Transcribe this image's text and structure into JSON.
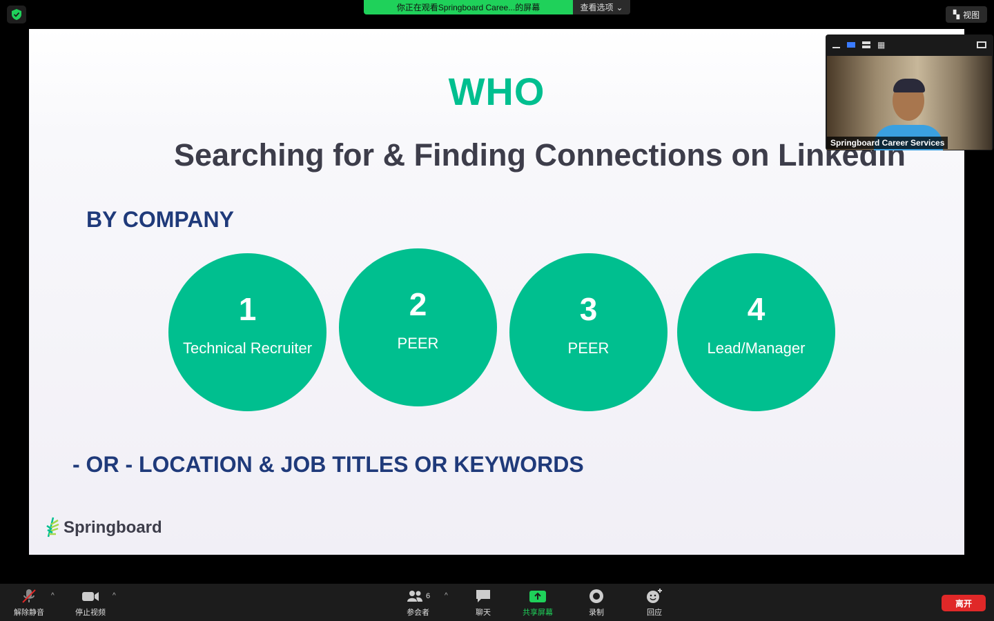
{
  "banner": {
    "viewing": "你正在观看Springboard Caree...的屏幕",
    "options": "查看选项"
  },
  "view_button": "视图",
  "slide": {
    "title": "WHO",
    "subtitle": "Searching for & Finding Connections on LinkedIn",
    "section": "BY COMPANY",
    "circles": [
      {
        "num": "1",
        "label": "Technical Recruiter"
      },
      {
        "num": "2",
        "label": "PEER"
      },
      {
        "num": "3",
        "label": "PEER"
      },
      {
        "num": "4",
        "label": "Lead/Manager"
      }
    ],
    "or_line": "- OR - LOCATION & JOB TITLES OR KEYWORDS",
    "logo": "Springboard"
  },
  "video": {
    "name": "Springboard Career Services"
  },
  "toolbar": {
    "unmute": "解除静音",
    "stop_video": "停止视频",
    "participants": "参会者",
    "participants_count": "6",
    "chat": "聊天",
    "share": "共享屏幕",
    "record": "录制",
    "reactions": "回应",
    "leave": "离开"
  },
  "colors": {
    "accent": "#00bf8f",
    "navy": "#1f3a7a",
    "zoom_green": "#1fd15a",
    "leave_red": "#e02828"
  }
}
